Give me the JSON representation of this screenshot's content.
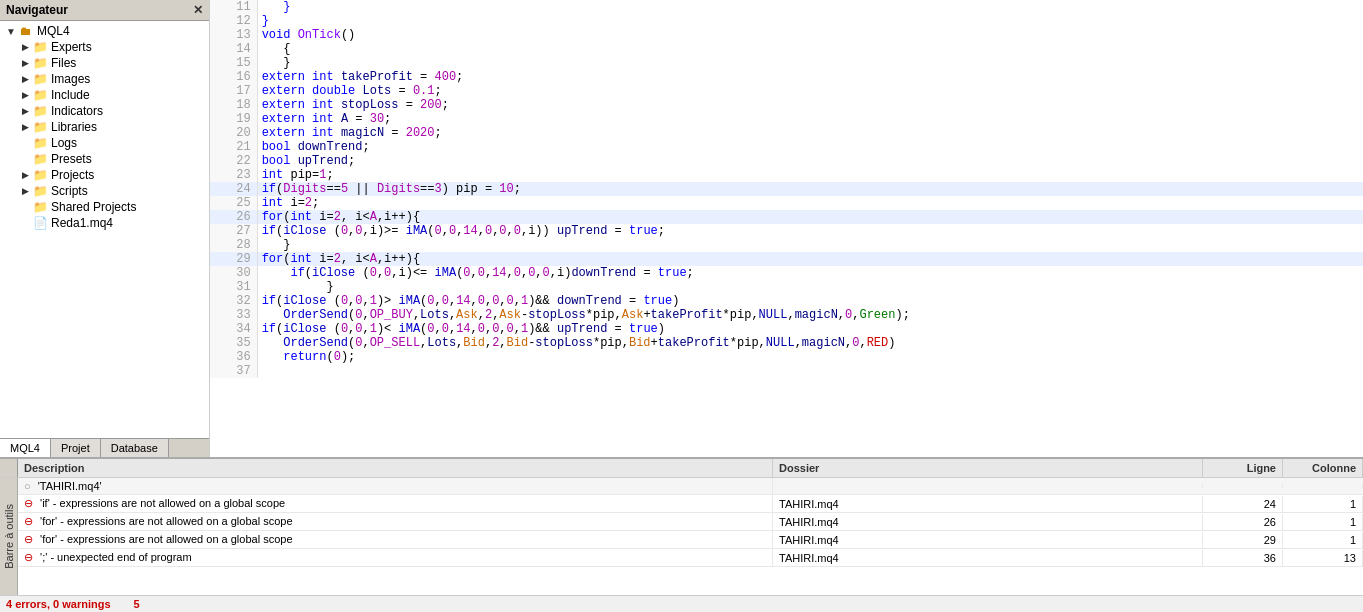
{
  "navigator": {
    "title": "Navigateur",
    "close_label": "✕",
    "tree": [
      {
        "id": "mql4",
        "label": "MQL4",
        "indent": 0,
        "expander": "▼",
        "icon": "mql4",
        "type": "root"
      },
      {
        "id": "experts",
        "label": "Experts",
        "indent": 1,
        "expander": "▷",
        "icon": "folder-yellow",
        "type": "folder"
      },
      {
        "id": "files",
        "label": "Files",
        "indent": 1,
        "expander": "▷",
        "icon": "folder-yellow",
        "type": "folder"
      },
      {
        "id": "images",
        "label": "Images",
        "indent": 1,
        "expander": "▷",
        "icon": "folder-yellow",
        "type": "folder"
      },
      {
        "id": "include",
        "label": "Include",
        "indent": 1,
        "expander": "▷",
        "icon": "folder-yellow",
        "type": "folder"
      },
      {
        "id": "indicators",
        "label": "Indicators",
        "indent": 1,
        "expander": "▷",
        "icon": "folder-yellow",
        "type": "folder"
      },
      {
        "id": "libraries",
        "label": "Libraries",
        "indent": 1,
        "expander": "▷",
        "icon": "folder-yellow",
        "type": "folder"
      },
      {
        "id": "logs",
        "label": "Logs",
        "indent": 1,
        "expander": "",
        "icon": "folder-yellow",
        "type": "folder"
      },
      {
        "id": "presets",
        "label": "Presets",
        "indent": 1,
        "expander": "",
        "icon": "folder-yellow",
        "type": "folder"
      },
      {
        "id": "projects",
        "label": "Projects",
        "indent": 1,
        "expander": "▷",
        "icon": "folder-yellow",
        "type": "folder"
      },
      {
        "id": "scripts",
        "label": "Scripts",
        "indent": 1,
        "expander": "▷",
        "icon": "folder-yellow",
        "type": "folder"
      },
      {
        "id": "shared-projects",
        "label": "Shared Projects",
        "indent": 1,
        "expander": "",
        "icon": "folder-blue",
        "type": "folder"
      },
      {
        "id": "reda1",
        "label": "Reda1.mq4",
        "indent": 1,
        "expander": "",
        "icon": "file",
        "type": "file"
      }
    ],
    "tabs": [
      {
        "id": "mql4",
        "label": "MQL4",
        "active": true
      },
      {
        "id": "projet",
        "label": "Projet",
        "active": false
      },
      {
        "id": "database",
        "label": "Database",
        "active": false
      }
    ]
  },
  "editor": {
    "lines": [
      {
        "num": 11,
        "content": "   }",
        "classes": ""
      },
      {
        "num": 12,
        "content": "}",
        "classes": ""
      },
      {
        "num": 13,
        "content": "void OnTick()",
        "classes": "kw-void"
      },
      {
        "num": 14,
        "content": "   {",
        "classes": ""
      },
      {
        "num": 15,
        "content": "   }",
        "classes": ""
      },
      {
        "num": 16,
        "content": "extern int takeProfit = 400;",
        "classes": ""
      },
      {
        "num": 17,
        "content": "extern double Lots = 0.1;",
        "classes": ""
      },
      {
        "num": 18,
        "content": "extern int stopLoss = 200;",
        "classes": ""
      },
      {
        "num": 19,
        "content": "extern int A = 30;",
        "classes": ""
      },
      {
        "num": 20,
        "content": "extern int magicN = 2020;",
        "classes": ""
      },
      {
        "num": 21,
        "content": "bool downTrend;",
        "classes": ""
      },
      {
        "num": 22,
        "content": "bool upTrend;",
        "classes": ""
      },
      {
        "num": 23,
        "content": "int pip=1;",
        "classes": ""
      },
      {
        "num": 24,
        "content": "if(Digits==5 || Digits==3) pip = 10;",
        "classes": "highlight"
      },
      {
        "num": 25,
        "content": "int i=2;",
        "classes": ""
      },
      {
        "num": 26,
        "content": "for(int i=2, i<A,i++){",
        "classes": "highlight"
      },
      {
        "num": 27,
        "content": "if(iClose (0,0,i)>= iMA(0,0,14,0,0,0,i)) upTrend = true;",
        "classes": ""
      },
      {
        "num": 28,
        "content": "   }",
        "classes": ""
      },
      {
        "num": 29,
        "content": "for(int i=2, i<A,i++){",
        "classes": "highlight"
      },
      {
        "num": 30,
        "content": "    if(iClose (0,0,i)<= iMA(0,0,14,0,0,0,i)downTrend = true;",
        "classes": ""
      },
      {
        "num": 31,
        "content": "         }",
        "classes": ""
      },
      {
        "num": 32,
        "content": "if(iClose (0,0,1)> iMA(0,0,14,0,0,0,1)&& downTrend = true)",
        "classes": ""
      },
      {
        "num": 33,
        "content": "   OrderSend(0,OP_BUY,Lots,Ask,2,Ask-stopLoss*pip,Ask+takeProfit*pip,NULL,magicN,0,Green);",
        "classes": ""
      },
      {
        "num": 34,
        "content": "if(iClose (0,0,1)< iMA(0,0,14,0,0,0,1)&& upTrend = true)",
        "classes": ""
      },
      {
        "num": 35,
        "content": "   OrderSend(0,OP_SELL,Lots,Bid,2,Bid-stopLoss*pip,Bid+takeProfit*pip,NULL,magicN,0,RED)",
        "classes": ""
      },
      {
        "num": 36,
        "content": "   return(0);",
        "classes": ""
      },
      {
        "num": 37,
        "content": "",
        "classes": ""
      }
    ]
  },
  "errors_panel": {
    "columns": {
      "description": "Description",
      "folder": "Dossier",
      "line": "Ligne",
      "column": "Colonne"
    },
    "rows": [
      {
        "type": "header",
        "description": "'TAHIRI.mq4'",
        "folder": "",
        "line": "",
        "column": ""
      },
      {
        "type": "error",
        "description": "'if' - expressions are not allowed on a global scope",
        "folder": "TAHIRI.mq4",
        "line": "24",
        "column": "1"
      },
      {
        "type": "error",
        "description": "'for' - expressions are not allowed on a global scope",
        "folder": "TAHIRI.mq4",
        "line": "26",
        "column": "1"
      },
      {
        "type": "error",
        "description": "'for' - expressions are not allowed on a global scope",
        "folder": "TAHIRI.mq4",
        "line": "29",
        "column": "1"
      },
      {
        "type": "error",
        "description": "';' - unexpected end of program",
        "folder": "TAHIRI.mq4",
        "line": "36",
        "column": "13"
      }
    ],
    "status": "4 errors, 0 warnings",
    "error_count": "5",
    "tool_label": "Barre à outils"
  }
}
